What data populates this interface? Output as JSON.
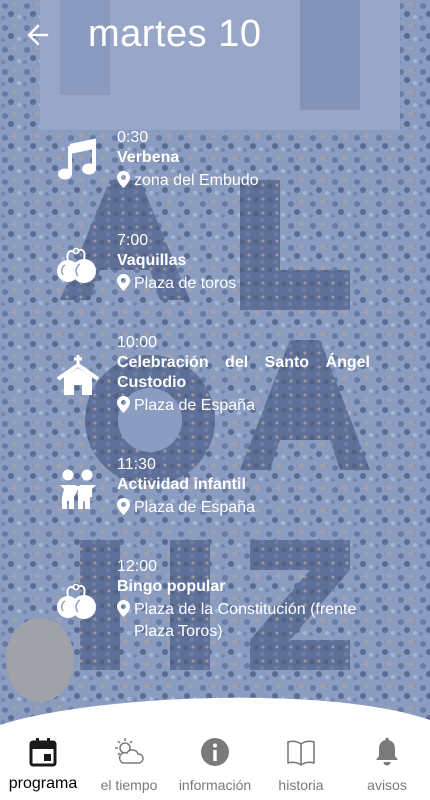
{
  "header": {
    "title": "martes 10"
  },
  "events": [
    {
      "time": "0:30",
      "name": "Verbena",
      "place": "zona del Embudo",
      "icon": "music-note-icon"
    },
    {
      "time": "7:00",
      "name": "Vaquillas",
      "place": "Plaza de toros",
      "icon": "castanets-icon"
    },
    {
      "time": "10:00",
      "name": "Celebración del Santo Ángel Custodio",
      "place": "Plaza de España",
      "icon": "church-icon"
    },
    {
      "time": "11:30",
      "name": "Actividad infantil",
      "place": "Plaza de España",
      "icon": "children-icon"
    },
    {
      "time": "12:00",
      "name": "Bingo popular",
      "place": "Plaza de la Constitución (frente Plaza Toros)",
      "icon": "castanets-icon"
    }
  ],
  "tabs": [
    {
      "label": "programa",
      "icon": "calendar-icon",
      "active": true
    },
    {
      "label": "el tiempo",
      "icon": "weather-icon",
      "active": false
    },
    {
      "label": "información",
      "icon": "info-icon",
      "active": false
    },
    {
      "label": "historia",
      "icon": "book-icon",
      "active": false
    },
    {
      "label": "avisos",
      "icon": "bell-icon",
      "active": false
    }
  ],
  "colors": {
    "overlay": "#7d91be",
    "text": "#ffffff",
    "tab_active": "#000000",
    "tab_inactive": "#7a7a7a"
  }
}
